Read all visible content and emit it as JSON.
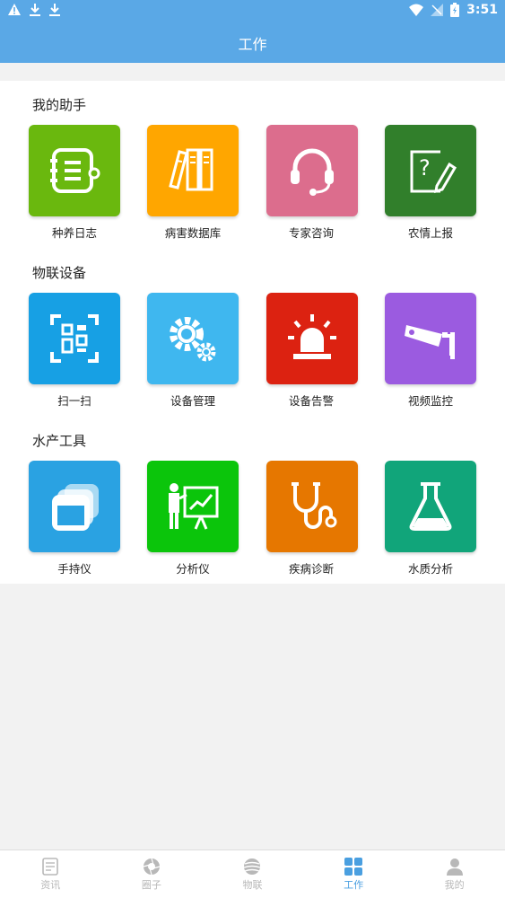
{
  "status_bar": {
    "time": "3:51"
  },
  "header": {
    "title": "工作"
  },
  "sections": [
    {
      "title": "我的助手",
      "items": [
        {
          "label": "种养日志",
          "color": "#6ab80e",
          "icon": "notebook-icon"
        },
        {
          "label": "病害数据库",
          "color": "#ffa600",
          "icon": "books-icon"
        },
        {
          "label": "专家咨询",
          "color": "#dc6d8d",
          "icon": "headset-icon"
        },
        {
          "label": "农情上报",
          "color": "#317f2b",
          "icon": "report-icon"
        }
      ]
    },
    {
      "title": "物联设备",
      "items": [
        {
          "label": "扫一扫",
          "color": "#17a0e4",
          "icon": "qr-scan-icon"
        },
        {
          "label": "设备管理",
          "color": "#3fb7ef",
          "icon": "gears-icon"
        },
        {
          "label": "设备告警",
          "color": "#dc2211",
          "icon": "alarm-light-icon"
        },
        {
          "label": "视频监控",
          "color": "#9b5be0",
          "icon": "camera-icon"
        }
      ]
    },
    {
      "title": "水产工具",
      "items": [
        {
          "label": "手持仪",
          "color": "#2aa2e2",
          "icon": "windows-icon"
        },
        {
          "label": "分析仪",
          "color": "#0bc50b",
          "icon": "presenter-icon"
        },
        {
          "label": "疾病诊断",
          "color": "#e67700",
          "icon": "stethoscope-icon"
        },
        {
          "label": "水质分析",
          "color": "#11a57a",
          "icon": "flask-icon"
        }
      ]
    }
  ],
  "tabs": [
    {
      "label": "资讯",
      "icon": "news-icon",
      "active": false
    },
    {
      "label": "圈子",
      "icon": "aperture-icon",
      "active": false
    },
    {
      "label": "物联",
      "icon": "globe-icon",
      "active": false
    },
    {
      "label": "工作",
      "icon": "grid-icon",
      "active": true
    },
    {
      "label": "我的",
      "icon": "user-icon",
      "active": false
    }
  ]
}
